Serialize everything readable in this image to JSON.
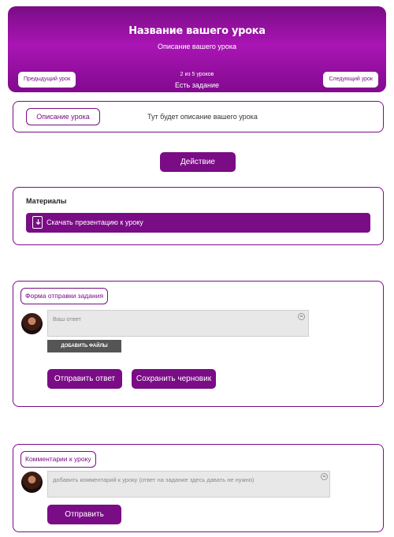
{
  "lesson": {
    "title": "Название вашего урока",
    "subtitle": "Описание вашего урока",
    "progress": "2 из 5 уроков",
    "task_status": "Есть задание",
    "prev_label": "Предыдущий урок",
    "next_label": "Следующий урок"
  },
  "description": {
    "button_label": "Описание урока",
    "text": "Тут будет описание вашего урока"
  },
  "action": {
    "label": "Действие"
  },
  "materials": {
    "title": "Материалы",
    "download_label": "Скачать презентацию к уроку"
  },
  "submission": {
    "title": "Форма отправки задания",
    "placeholder": "Ваш ответ",
    "files_label": "ДОБАВИТЬ ФАЙЛЫ",
    "send_label": "Отправить ответ",
    "draft_label": "Сохранить черновик"
  },
  "comments": {
    "title": "Комментарии к уроку",
    "placeholder": "добавить комментарий к уроку (ответ на задание здесь давать не нужно)",
    "send_label": "Отправить"
  },
  "colors": {
    "accent": "#7a0c86",
    "gradient_mid": "#a915b4"
  },
  "icons": [
    "download-icon",
    "emoji-icon",
    "avatar"
  ]
}
